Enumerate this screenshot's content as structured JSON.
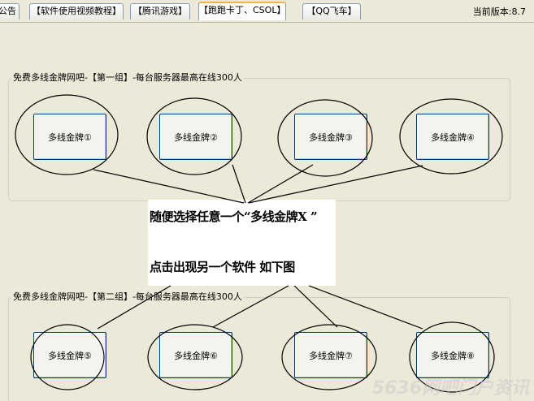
{
  "tabs": [
    {
      "label": "公告"
    },
    {
      "label": "【软件使用视频教程】"
    },
    {
      "label": "【腾讯游戏】"
    },
    {
      "label": "【跑跑卡丁、CSOL】"
    },
    {
      "label": "【QQ飞车】"
    }
  ],
  "version_label": "当前版本:8.7",
  "group1": {
    "title": "免费多线金牌网吧-【第一组】-每台服务器最高在线300人",
    "buttons": [
      "多线金牌①",
      "多线金牌②",
      "多线金牌③",
      "多线金牌④"
    ]
  },
  "group2": {
    "title": "免费多线金牌网吧-【第二组】-每台服务器最高在线300人",
    "buttons": [
      "多线金牌⑤",
      "多线金牌⑥",
      "多线金牌⑦",
      "多线金牌⑧"
    ]
  },
  "annotation": {
    "line1": "随便选择任意一个“多线金牌X ”",
    "line2": "点击出现另一个软件  如下图"
  },
  "watermark": "5636网吧门户资讯"
}
